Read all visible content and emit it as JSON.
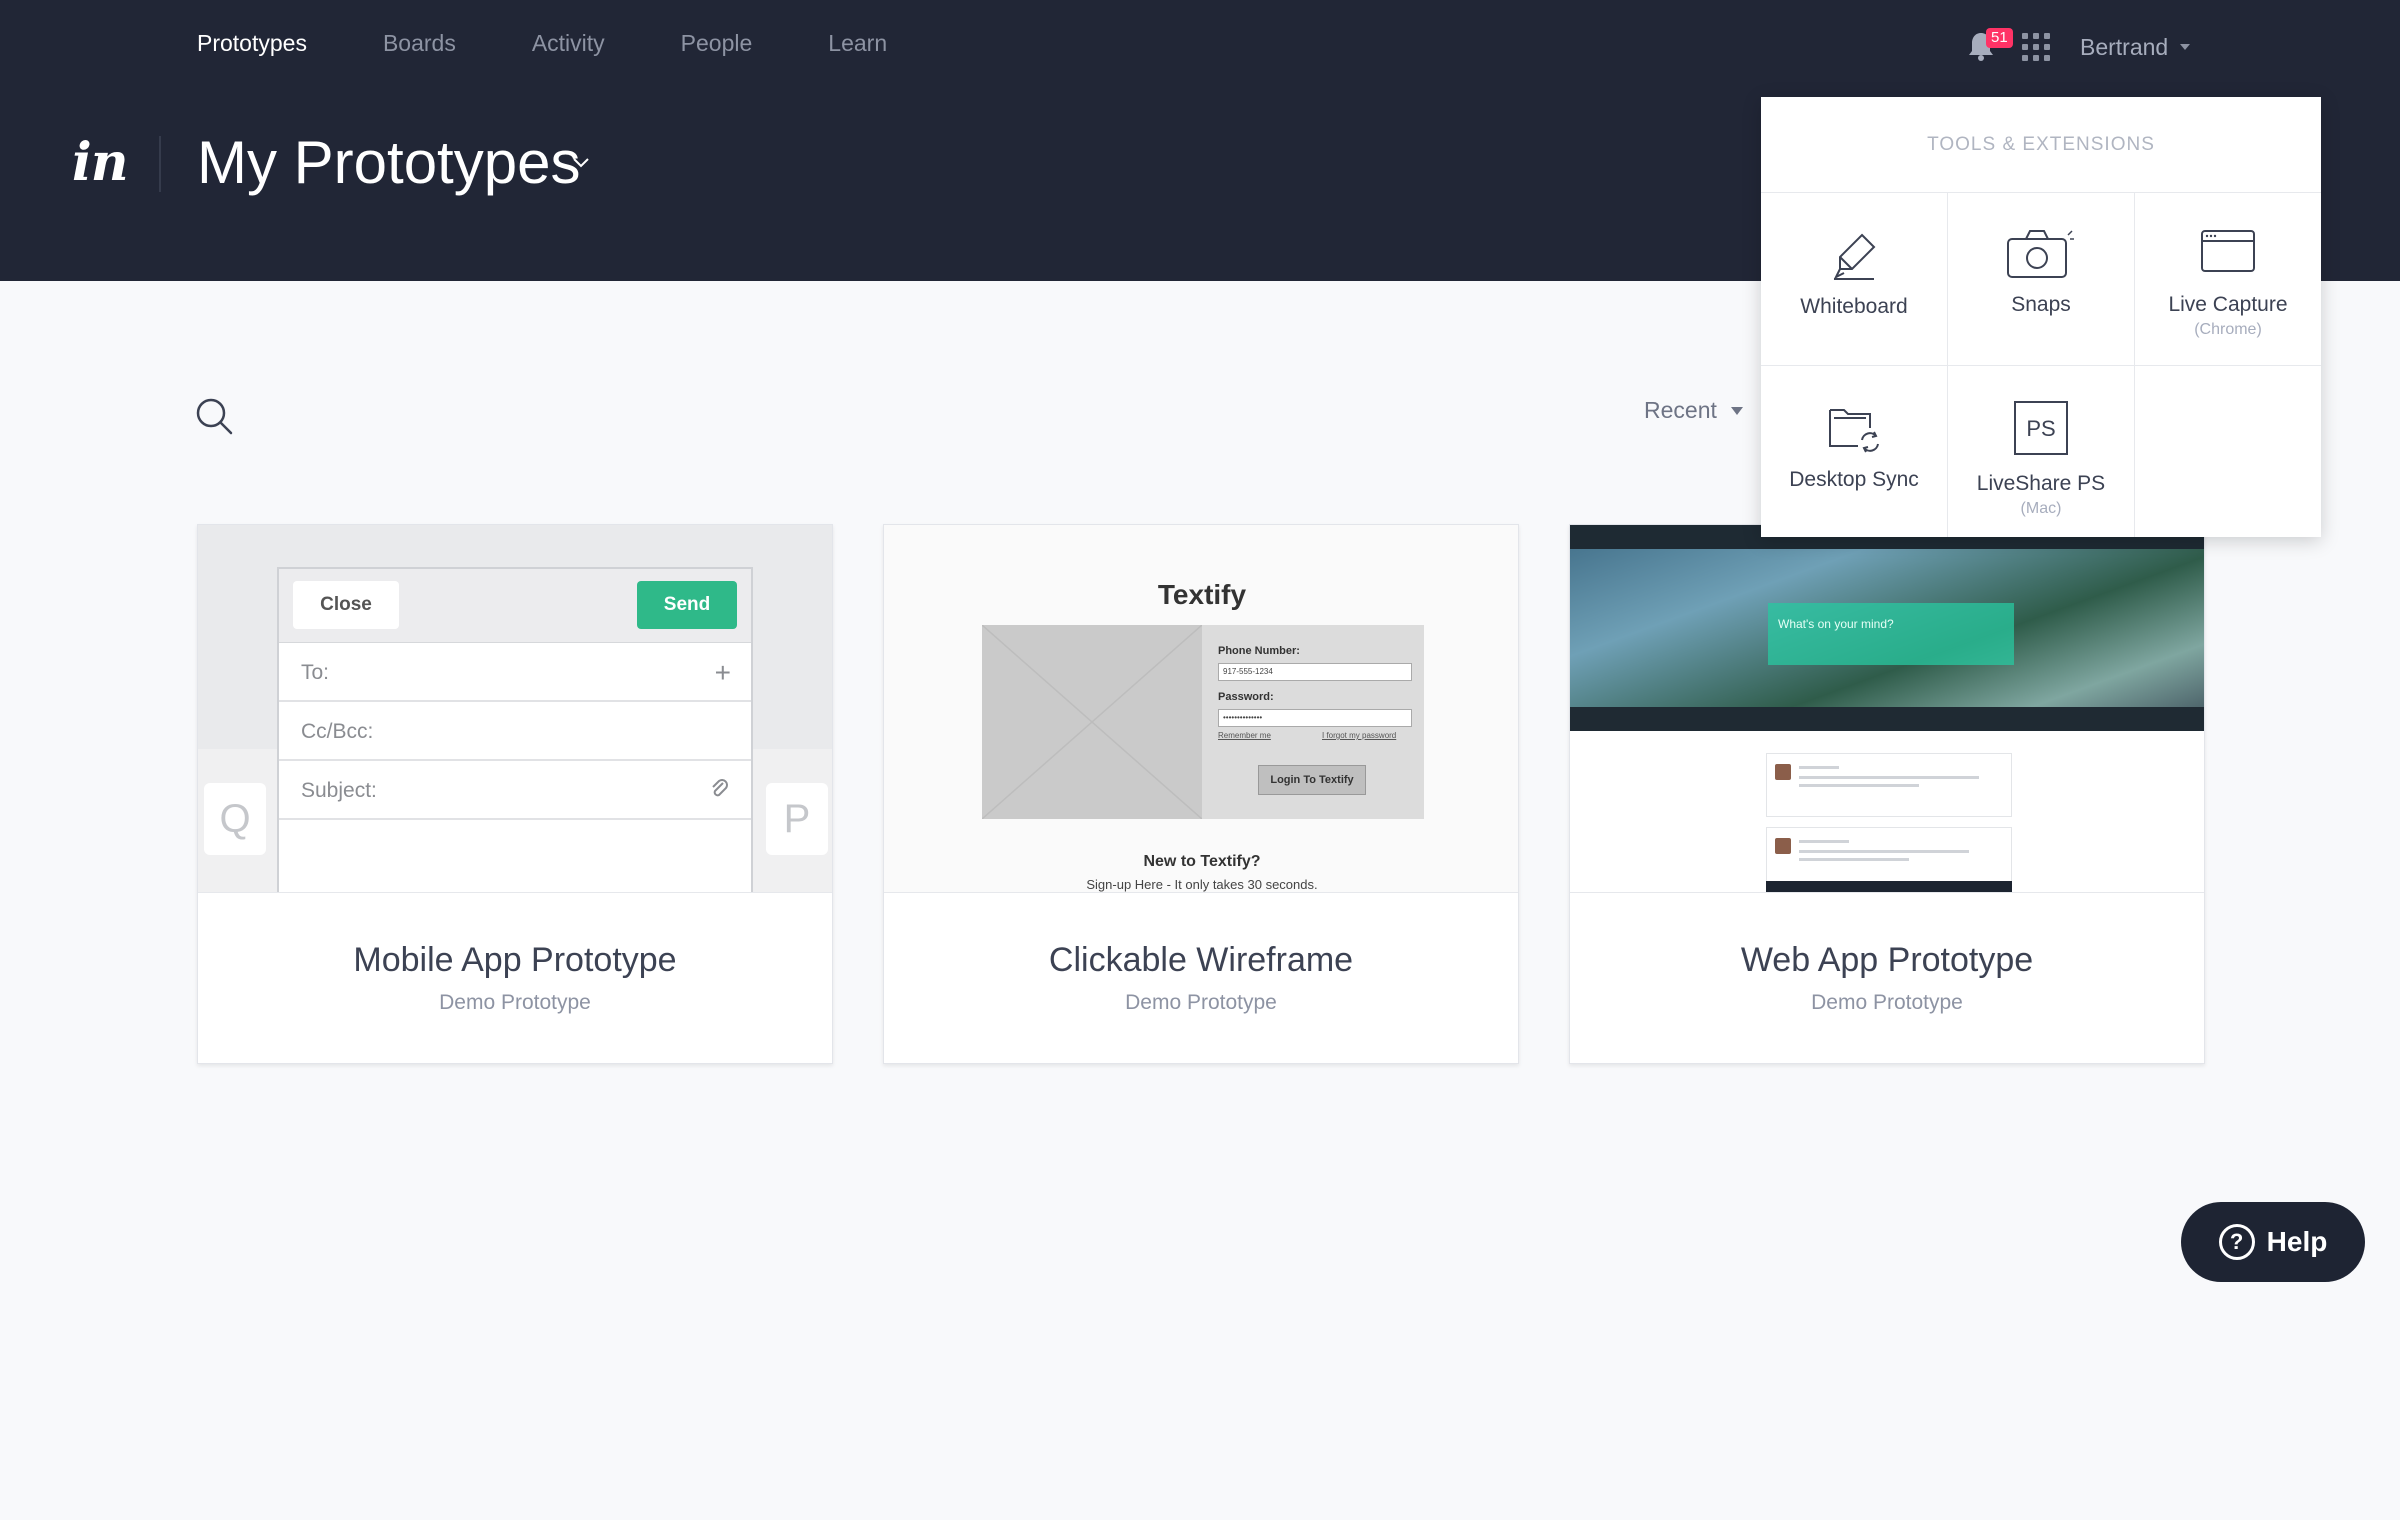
{
  "nav": {
    "items": [
      {
        "label": "Prototypes",
        "active": true
      },
      {
        "label": "Boards",
        "active": false
      },
      {
        "label": "Activity",
        "active": false
      },
      {
        "label": "People",
        "active": false
      },
      {
        "label": "Learn",
        "active": false
      }
    ]
  },
  "header": {
    "logo": "in",
    "page_title": "My Prototypes",
    "notifications_count": "51",
    "user_name": "Bertrand"
  },
  "toolbar": {
    "sort_label": "Recent"
  },
  "cards": [
    {
      "title": "Mobile App Prototype",
      "subtitle": "Demo Prototype",
      "thumb": {
        "close": "Close",
        "send": "Send",
        "to": "To:",
        "ccbcc": "Cc/Bcc:",
        "subject": "Subject:",
        "key_left": "Q",
        "key_right": "P"
      }
    },
    {
      "title": "Clickable Wireframe",
      "subtitle": "Demo Prototype",
      "thumb": {
        "title": "Textify",
        "phone_label": "Phone Number:",
        "phone_value": "917-555-1234",
        "password_label": "Password:",
        "password_value": "••••••••••••••",
        "remember": "Remember me",
        "forgot": "I forgot my password",
        "login": "Login To Textify",
        "new_to": "New to Textify?",
        "signup": "Sign-up Here - It only takes 30 seconds."
      }
    },
    {
      "title": "Web App Prototype",
      "subtitle": "Demo Prototype",
      "thumb": {
        "prompt": "What's on your mind?"
      }
    }
  ],
  "tools": {
    "heading": "TOOLS & EXTENSIONS",
    "items": [
      {
        "label": "Whiteboard",
        "icon": "whiteboard-icon"
      },
      {
        "label": "Snaps",
        "icon": "camera-icon"
      },
      {
        "label": "Live Capture",
        "sub": "(Chrome)",
        "icon": "browser-window-icon"
      },
      {
        "label": "Desktop Sync",
        "icon": "folder-sync-icon"
      },
      {
        "label": "LiveShare PS",
        "sub": "(Mac)",
        "icon": "photoshop-icon",
        "icon_text": "PS"
      }
    ]
  },
  "help": {
    "label": "Help",
    "icon_text": "?"
  },
  "colors": {
    "header_bg": "#212636",
    "page_bg": "#f8f9fb",
    "badge": "#ff3366",
    "send_button": "#2fb989",
    "help_bg": "#1e2433"
  }
}
